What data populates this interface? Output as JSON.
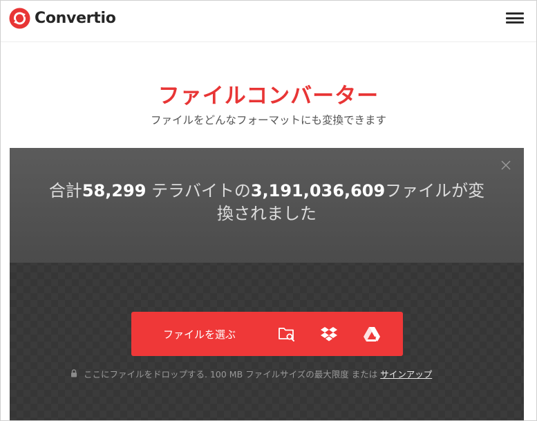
{
  "header": {
    "brand": "Convertio",
    "logo_icon": "convertio-logo-icon",
    "menu_icon": "hamburger-menu-icon"
  },
  "hero": {
    "title": "ファイルコンバーター",
    "subtitle": "ファイルをどんなフォーマットにも変換できます"
  },
  "stats": {
    "prefix": "合計",
    "terabytes": "58,299",
    "middle": " テラバイトの",
    "files": "3,191,036,609",
    "suffix": "ファイルが変換されました"
  },
  "upload": {
    "choose_label": "ファイルを選ぶ",
    "sources": [
      "folder-search-icon",
      "dropbox-icon",
      "google-drive-icon"
    ],
    "hint": "ここにファイルをドロップする. 100 MB ファイルサイズの最大限度 または",
    "signup_link": "サインアップ"
  },
  "colors": {
    "brand_red": "#e83535",
    "button_red": "#ef3838",
    "dark_bg": "#363636"
  }
}
